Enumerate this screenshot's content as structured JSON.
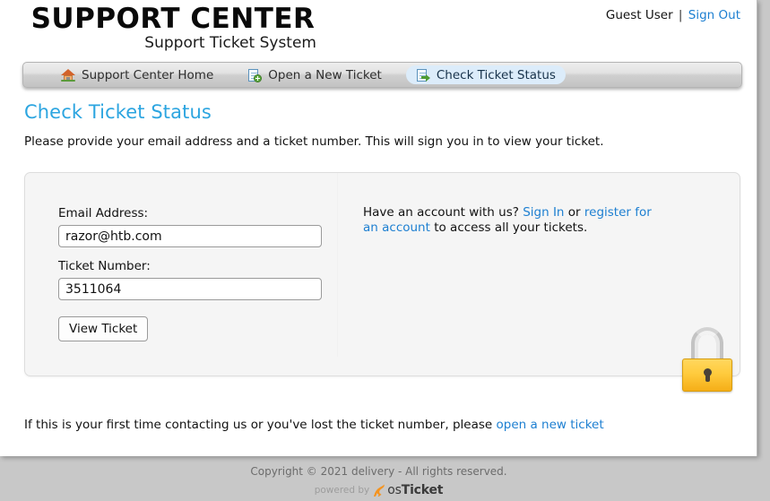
{
  "branding": {
    "title": "SUPPORT CENTER",
    "subtitle": "Support Ticket System"
  },
  "user_nav": {
    "user_label": "Guest User",
    "separator": "|",
    "signout_label": "Sign Out"
  },
  "navbar": {
    "items": [
      {
        "label": "Support Center Home",
        "icon": "home-icon",
        "active": false
      },
      {
        "label": "Open a New Ticket",
        "icon": "new-document-icon",
        "active": false
      },
      {
        "label": "Check Ticket Status",
        "icon": "document-arrow-icon",
        "active": true
      }
    ]
  },
  "main": {
    "page_title": "Check Ticket Status",
    "intro": "Please provide your email address and a ticket number. This will sign you in to view your ticket.",
    "form": {
      "email_label": "Email Address:",
      "email_value": "razor@htb.com",
      "email_placeholder": "",
      "ticket_label": "Ticket Number:",
      "ticket_value": "3511064",
      "ticket_placeholder": "",
      "submit_label": "View Ticket"
    },
    "account": {
      "lead": "Have an account with us?",
      "signin_label": "Sign In",
      "conjunction": "or",
      "register_label": "register for an account",
      "tail": "to access all your tickets."
    },
    "lock_icon": "padlock-icon",
    "bottom_note": {
      "text": "If this is your first time contacting us or you've lost the ticket number, please",
      "link_label": "open a new ticket"
    }
  },
  "footer": {
    "copyright": "Copyright © 2021 delivery - All rights reserved.",
    "powered_by": "powered by",
    "brand_os": "os",
    "brand_ticket": "Ticket"
  },
  "colors": {
    "accent_blue": "#2ca5e0",
    "link_blue": "#1d7fd1",
    "active_tab_bg": "#dcecfa",
    "panel_bg": "#f5f5f5",
    "page_bg": "#c8c8c8",
    "lock_yellow": "#ffcb3d",
    "kangaroo_orange": "#f5931e"
  }
}
